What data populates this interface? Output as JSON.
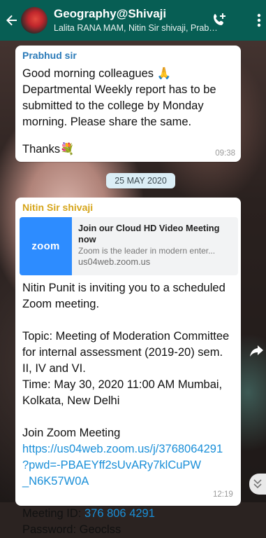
{
  "header": {
    "title": "Geography@Shivaji",
    "members": "Lalita RANA MAM, Nitin Sir shivaji, Prabhu..."
  },
  "messages": [
    {
      "sender": "Prabhud sir",
      "sender_color": "#2a7ab8",
      "line1": "Good morning colleagues 🙏",
      "line2": "Departmental Weekly report has to be",
      "line3": "submitted to the college by Monday",
      "line4": "morning. Please share the same.",
      "line5": "Thanks💐",
      "time": "09:38"
    },
    {
      "sender": "Nitin Sir shivaji",
      "sender_color": "#d6a51a",
      "preview": {
        "logo_text": "zoom",
        "title_line1": "Join our Cloud HD Video Meeting",
        "title_line2": "now",
        "description": "Zoom is the leader in modern enter...",
        "url": "us04web.zoom.us"
      },
      "lines": [
        "Nitin Punit is inviting you to a scheduled",
        "Zoom meeting.",
        "",
        "Topic: Meeting of Moderation Committee",
        "for internal assessment (2019-20) sem.",
        "II, IV and VI.",
        "Time: May 30, 2020 11:00 AM Mumbai,",
        "Kolkata, New Delhi",
        "",
        "Join Zoom Meeting"
      ],
      "link_lines": [
        "https://us04web.zoom.us/j/3768064291",
        "?pwd=-PBAEYff2sUvARy7klCuPW",
        "_N6K57W0A"
      ],
      "meeting_id_label": "Meeting ID: ",
      "meeting_id": "376 806 4291",
      "password": "Password: Geoclss",
      "time": "12:19"
    }
  ],
  "date_divider": "25 MAY 2020",
  "colors": {
    "header_bg": "#075e54",
    "link": "#1a8fd8",
    "zoom_blue": "#2d8cff"
  },
  "icons": [
    "back-arrow-icon",
    "add-call-icon",
    "more-vert-icon",
    "share-icon",
    "chevron-down-icon"
  ]
}
